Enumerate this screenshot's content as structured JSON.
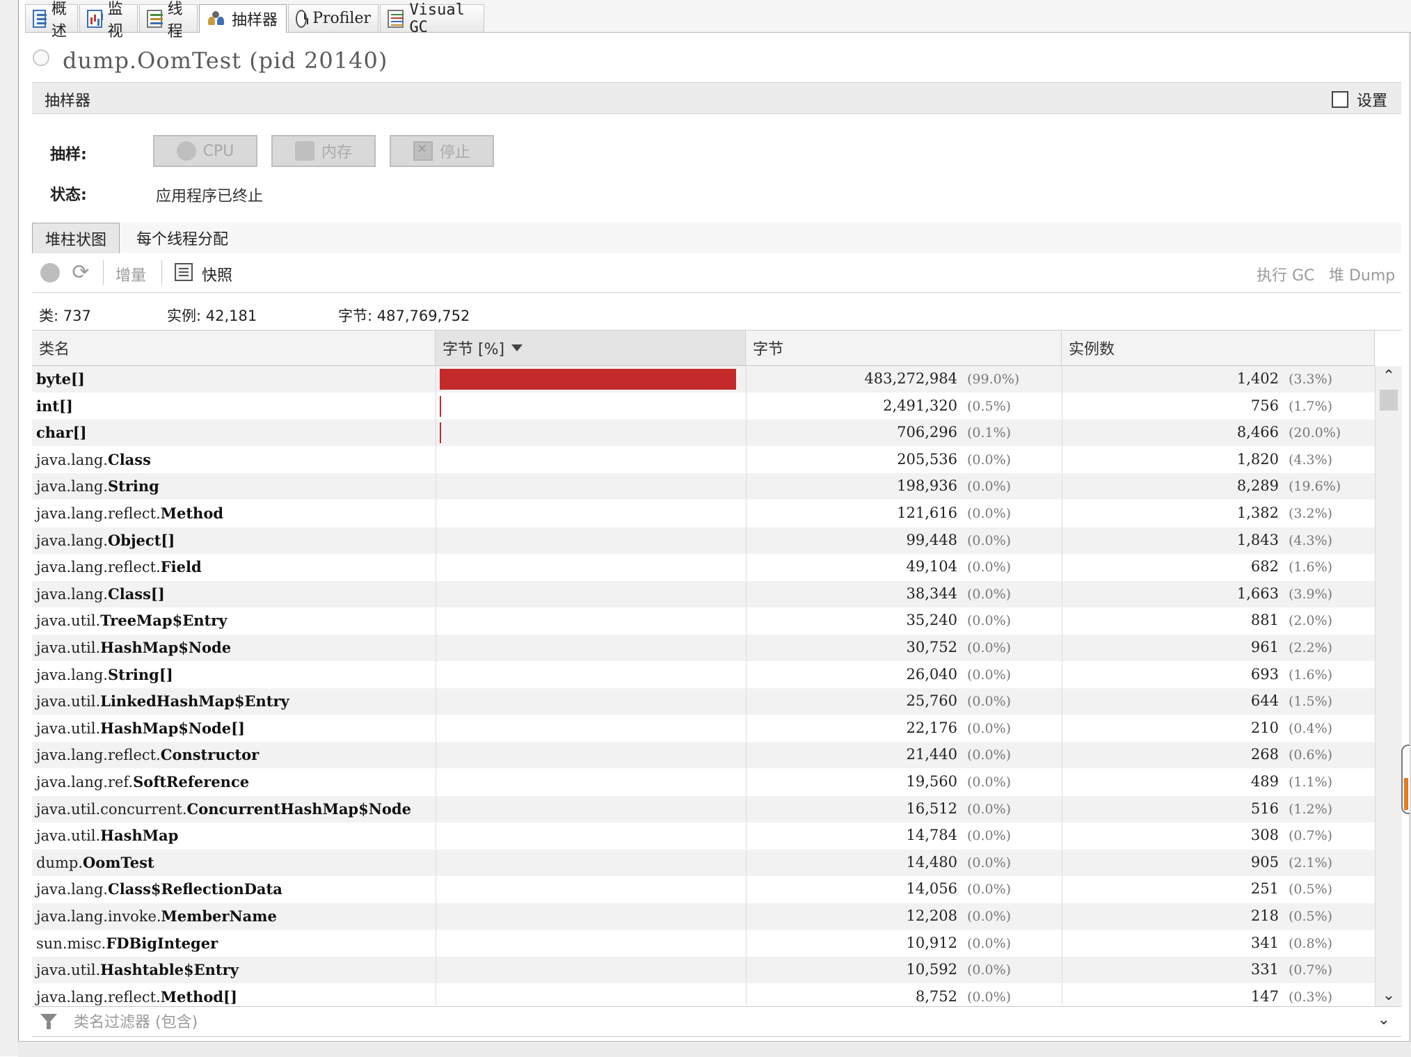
{
  "tabs": [
    {
      "label": "概述",
      "icon": "overview-icon",
      "active": false
    },
    {
      "label": "监视",
      "icon": "monitor-icon",
      "active": false
    },
    {
      "label": "线程",
      "icon": "threads-icon",
      "active": false
    },
    {
      "label": "抽样器",
      "icon": "sampler-icon",
      "active": true
    },
    {
      "label": "Profiler",
      "icon": "profiler-icon",
      "active": false
    },
    {
      "label": "Visual GC",
      "icon": "visual-gc-icon",
      "active": false
    }
  ],
  "process": {
    "title": "dump.OomTest (pid 20140)"
  },
  "sampler": {
    "header": "抽样器",
    "settings_label": "设置",
    "sampling_label": "抽样:",
    "status_label": "状态:",
    "status_value": "应用程序已终止",
    "cpu_button": "CPU",
    "memory_button": "内存",
    "stop_button": "停止"
  },
  "subtabs": {
    "heap_histogram": "堆柱状图",
    "per_thread": "每个线程分配"
  },
  "toolbar": {
    "delta": "增量",
    "snapshot": "快照",
    "perform_gc": "执行 GC",
    "heap_dump": "堆 Dump"
  },
  "summary": {
    "classes": "类: 737",
    "instances": "实例: 42,181",
    "bytes": "字节: 487,769,752"
  },
  "table": {
    "columns": {
      "name": "类名",
      "bytes_pct": "字节 [%]",
      "bytes": "字节",
      "instances": "实例数"
    },
    "rows": [
      {
        "pkg": "",
        "cls": "byte[]",
        "bytes": "483,272,984",
        "bytes_pct": "(99.0%)",
        "share": 0.99,
        "instances": "1,402",
        "inst_pct": "(3.3%)"
      },
      {
        "pkg": "",
        "cls": "int[]",
        "bytes": "2,491,320",
        "bytes_pct": "(0.5%)",
        "share": 0.005,
        "instances": "756",
        "inst_pct": "(1.7%)"
      },
      {
        "pkg": "",
        "cls": "char[]",
        "bytes": "706,296",
        "bytes_pct": "(0.1%)",
        "share": 0.001,
        "instances": "8,466",
        "inst_pct": "(20.0%)"
      },
      {
        "pkg": "java.lang.",
        "cls": "Class",
        "bytes": "205,536",
        "bytes_pct": "(0.0%)",
        "share": 0,
        "instances": "1,820",
        "inst_pct": "(4.3%)"
      },
      {
        "pkg": "java.lang.",
        "cls": "String",
        "bytes": "198,936",
        "bytes_pct": "(0.0%)",
        "share": 0,
        "instances": "8,289",
        "inst_pct": "(19.6%)"
      },
      {
        "pkg": "java.lang.reflect.",
        "cls": "Method",
        "bytes": "121,616",
        "bytes_pct": "(0.0%)",
        "share": 0,
        "instances": "1,382",
        "inst_pct": "(3.2%)"
      },
      {
        "pkg": "java.lang.",
        "cls": "Object[]",
        "bytes": "99,448",
        "bytes_pct": "(0.0%)",
        "share": 0,
        "instances": "1,843",
        "inst_pct": "(4.3%)"
      },
      {
        "pkg": "java.lang.reflect.",
        "cls": "Field",
        "bytes": "49,104",
        "bytes_pct": "(0.0%)",
        "share": 0,
        "instances": "682",
        "inst_pct": "(1.6%)"
      },
      {
        "pkg": "java.lang.",
        "cls": "Class[]",
        "bytes": "38,344",
        "bytes_pct": "(0.0%)",
        "share": 0,
        "instances": "1,663",
        "inst_pct": "(3.9%)"
      },
      {
        "pkg": "java.util.",
        "cls": "TreeMap$Entry",
        "bytes": "35,240",
        "bytes_pct": "(0.0%)",
        "share": 0,
        "instances": "881",
        "inst_pct": "(2.0%)"
      },
      {
        "pkg": "java.util.",
        "cls": "HashMap$Node",
        "bytes": "30,752",
        "bytes_pct": "(0.0%)",
        "share": 0,
        "instances": "961",
        "inst_pct": "(2.2%)"
      },
      {
        "pkg": "java.lang.",
        "cls": "String[]",
        "bytes": "26,040",
        "bytes_pct": "(0.0%)",
        "share": 0,
        "instances": "693",
        "inst_pct": "(1.6%)"
      },
      {
        "pkg": "java.util.",
        "cls": "LinkedHashMap$Entry",
        "bytes": "25,760",
        "bytes_pct": "(0.0%)",
        "share": 0,
        "instances": "644",
        "inst_pct": "(1.5%)"
      },
      {
        "pkg": "java.util.",
        "cls": "HashMap$Node[]",
        "bytes": "22,176",
        "bytes_pct": "(0.0%)",
        "share": 0,
        "instances": "210",
        "inst_pct": "(0.4%)"
      },
      {
        "pkg": "java.lang.reflect.",
        "cls": "Constructor",
        "bytes": "21,440",
        "bytes_pct": "(0.0%)",
        "share": 0,
        "instances": "268",
        "inst_pct": "(0.6%)"
      },
      {
        "pkg": "java.lang.ref.",
        "cls": "SoftReference",
        "bytes": "19,560",
        "bytes_pct": "(0.0%)",
        "share": 0,
        "instances": "489",
        "inst_pct": "(1.1%)"
      },
      {
        "pkg": "java.util.concurrent.",
        "cls": "ConcurrentHashMap$Node",
        "bytes": "16,512",
        "bytes_pct": "(0.0%)",
        "share": 0,
        "instances": "516",
        "inst_pct": "(1.2%)"
      },
      {
        "pkg": "java.util.",
        "cls": "HashMap",
        "bytes": "14,784",
        "bytes_pct": "(0.0%)",
        "share": 0,
        "instances": "308",
        "inst_pct": "(0.7%)"
      },
      {
        "pkg": "dump.",
        "cls": "OomTest",
        "bytes": "14,480",
        "bytes_pct": "(0.0%)",
        "share": 0,
        "instances": "905",
        "inst_pct": "(2.1%)"
      },
      {
        "pkg": "java.lang.",
        "cls": "Class$ReflectionData",
        "bytes": "14,056",
        "bytes_pct": "(0.0%)",
        "share": 0,
        "instances": "251",
        "inst_pct": "(0.5%)"
      },
      {
        "pkg": "java.lang.invoke.",
        "cls": "MemberName",
        "bytes": "12,208",
        "bytes_pct": "(0.0%)",
        "share": 0,
        "instances": "218",
        "inst_pct": "(0.5%)"
      },
      {
        "pkg": "sun.misc.",
        "cls": "FDBigInteger",
        "bytes": "10,912",
        "bytes_pct": "(0.0%)",
        "share": 0,
        "instances": "341",
        "inst_pct": "(0.8%)"
      },
      {
        "pkg": "java.util.",
        "cls": "Hashtable$Entry",
        "bytes": "10,592",
        "bytes_pct": "(0.0%)",
        "share": 0,
        "instances": "331",
        "inst_pct": "(0.7%)"
      },
      {
        "pkg": "java.lang.reflect.",
        "cls": "Method[]",
        "bytes": "8,752",
        "bytes_pct": "(0.0%)",
        "share": 0,
        "instances": "147",
        "inst_pct": "(0.3%)"
      }
    ]
  },
  "filter": {
    "placeholder": "类名过滤器 (包含)"
  },
  "colors": {
    "bar": "#c42a2a",
    "accent_knob": "#e87a1e"
  }
}
